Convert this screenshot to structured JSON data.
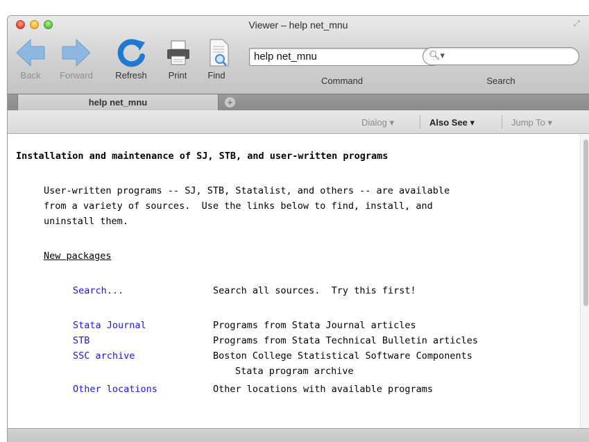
{
  "window": {
    "title": "Viewer – help net_mnu"
  },
  "toolbar": {
    "back_label": "Back",
    "forward_label": "Forward",
    "refresh_label": "Refresh",
    "print_label": "Print",
    "find_label": "Find",
    "command_value": "help net_mnu",
    "command_label": "Command",
    "search_placeholder": "",
    "search_label": "Search"
  },
  "tabs": [
    {
      "label": "help net_mnu",
      "active": true
    }
  ],
  "subbar": {
    "dialog_label": "Dialog ▾",
    "also_see_label": "Also See ▾",
    "jump_to_label": "Jump To ▾"
  },
  "content": {
    "heading": "Installation and maintenance of SJ, STB, and user-written programs",
    "intro": [
      "User-written programs -- SJ, STB, Statalist, and others -- are available",
      "from a variety of sources.  Use the links below to find, install, and",
      "uninstall them."
    ],
    "section_title": "New packages",
    "entries": [
      {
        "link": "Search...",
        "desc": "Search all sources.  Try this first!"
      },
      {
        "link": "Stata Journal",
        "desc": "Programs from Stata Journal articles"
      },
      {
        "link": "STB",
        "desc": "Programs from Stata Technical Bulletin articles"
      },
      {
        "link": "SSC archive",
        "desc": "Boston College Statistical Software Components"
      },
      {
        "link": "",
        "desc": "Stata program archive"
      },
      {
        "link": "Other locations",
        "desc": "Other locations with available programs"
      }
    ]
  },
  "colors": {
    "link": "#1a1ad6",
    "back_arrow": "#7fb0e0",
    "refresh": "#1f78d1"
  }
}
